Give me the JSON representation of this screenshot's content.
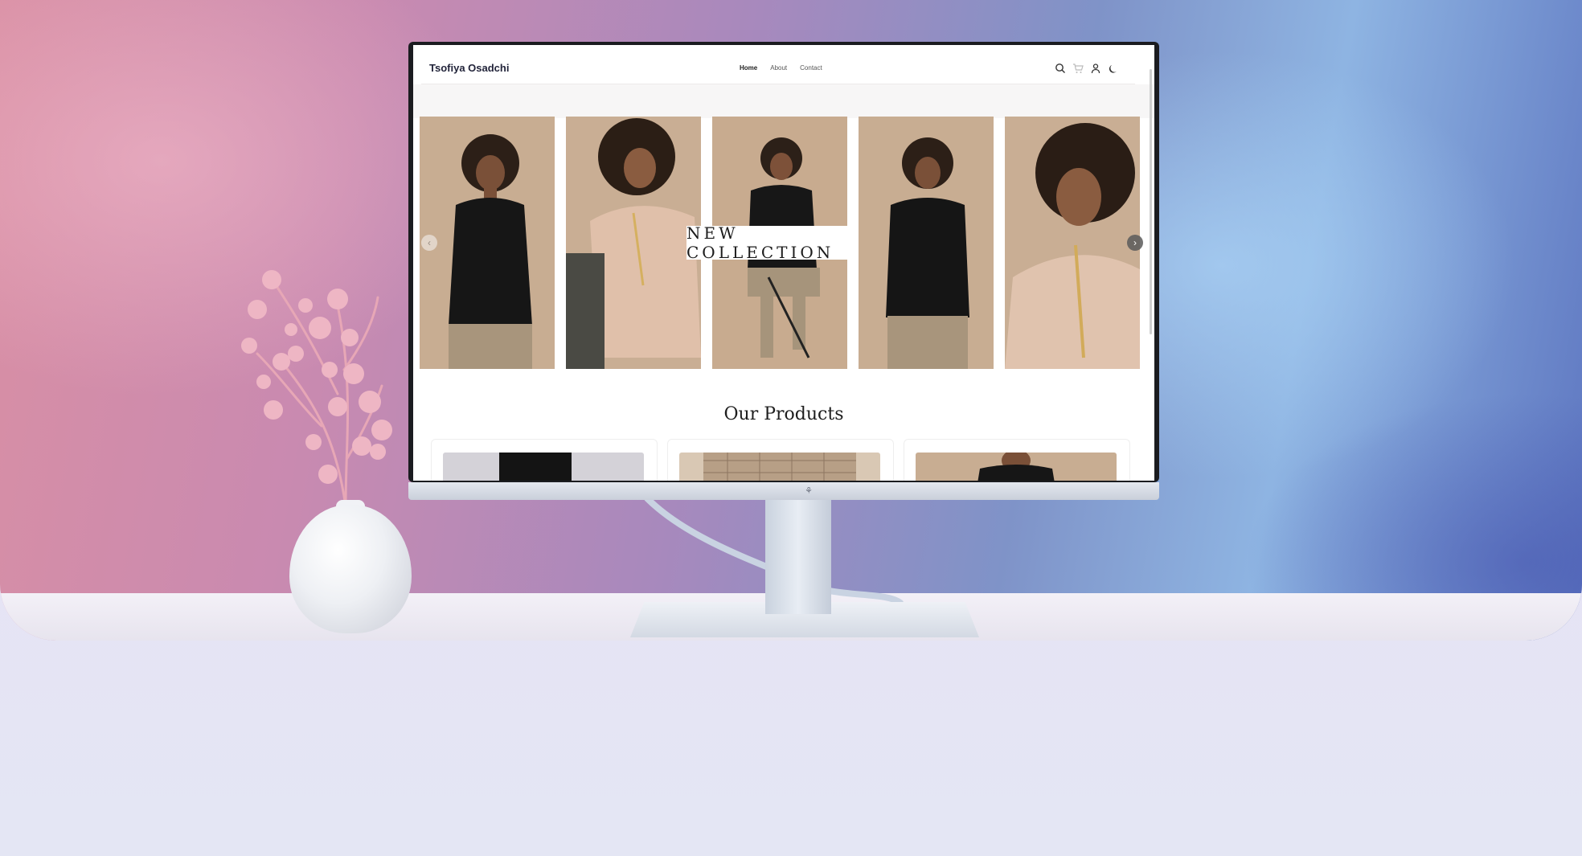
{
  "site": {
    "brand": "Tsofiya Osadchi",
    "menu": [
      {
        "label": "Home",
        "active": true
      },
      {
        "label": "About",
        "active": false
      },
      {
        "label": "Contact",
        "active": false
      }
    ],
    "icons": [
      "search-icon",
      "cart-icon",
      "user-icon",
      "moon-icon"
    ]
  },
  "hero": {
    "badge": "NEW COLLECTION",
    "photos": [
      {
        "name": "model-black-blazer"
      },
      {
        "name": "model-beige-blazer"
      },
      {
        "name": "model-seated-chair"
      },
      {
        "name": "model-black-blazer-2"
      },
      {
        "name": "model-beige-blazer-closeup"
      }
    ],
    "prev_arrow": "‹",
    "next_arrow": "›"
  },
  "products": {
    "title": "Our Products",
    "cards": [
      {
        "name": "product-black-top"
      },
      {
        "name": "product-check-jacket"
      },
      {
        "name": "product-black-blazer"
      }
    ]
  },
  "monitor": {
    "logo": "⚘"
  },
  "colors": {
    "brand_text": "#22243a",
    "photo_bg": "#c9ad90",
    "blazer_black": "#1a1a1a",
    "blazer_beige": "#e0c2ad"
  }
}
